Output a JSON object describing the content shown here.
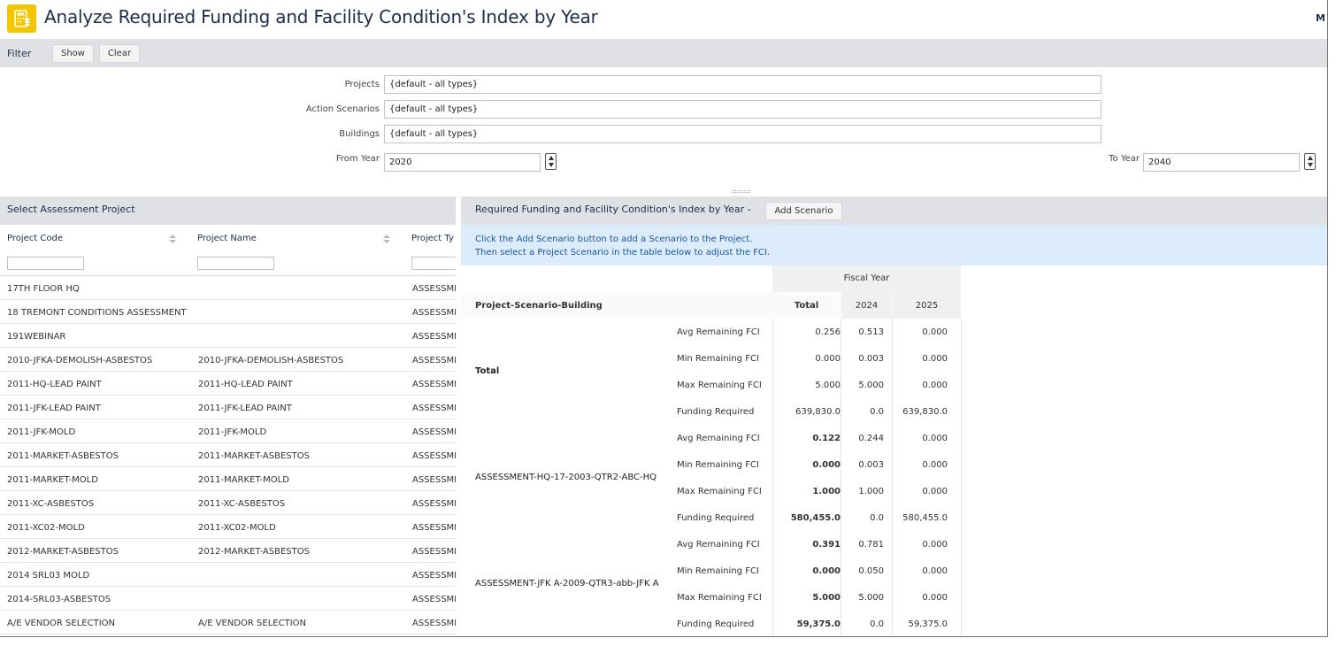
{
  "title": "Analyze Required Funding and Facility Condition's Index by Year",
  "user_initial": "M",
  "filter": {
    "label": "Filter",
    "show_label": "Show",
    "clear_label": "Clear",
    "projects_label": "Projects",
    "projects_value": "{default - all types}",
    "scenarios_label": "Action Scenarios",
    "scenarios_value": "{default - all types}",
    "buildings_label": "Buildings",
    "buildings_value": "{default - all types}",
    "from_year_label": "From Year",
    "from_year_value": "2020",
    "to_year_label": "To Year",
    "to_year_value": "2040"
  },
  "left_panel": {
    "title": "Select Assessment Project",
    "columns": [
      "Project Code",
      "Project Name",
      "Project Ty"
    ],
    "rows": [
      {
        "code": "17TH FLOOR HQ",
        "name": "",
        "type": "ASSESSME"
      },
      {
        "code": "18 TREMONT CONDITIONS ASSESSMENT",
        "name": "",
        "type": "ASSESSME"
      },
      {
        "code": "191WEBINAR",
        "name": "",
        "type": "ASSESSME"
      },
      {
        "code": "2010-JFKA-DEMOLISH-ASBESTOS",
        "name": "2010-JFKA-DEMOLISH-ASBESTOS",
        "type": "ASSESSME"
      },
      {
        "code": "2011-HQ-LEAD PAINT",
        "name": "2011-HQ-LEAD PAINT",
        "type": "ASSESSME"
      },
      {
        "code": "2011-JFK-LEAD PAINT",
        "name": "2011-JFK-LEAD PAINT",
        "type": "ASSESSME"
      },
      {
        "code": "2011-JFK-MOLD",
        "name": "2011-JFK-MOLD",
        "type": "ASSESSME"
      },
      {
        "code": "2011-MARKET-ASBESTOS",
        "name": "2011-MARKET-ASBESTOS",
        "type": "ASSESSME"
      },
      {
        "code": "2011-MARKET-MOLD",
        "name": "2011-MARKET-MOLD",
        "type": "ASSESSME"
      },
      {
        "code": "2011-XC-ASBESTOS",
        "name": "2011-XC-ASBESTOS",
        "type": "ASSESSME"
      },
      {
        "code": "2011-XC02-MOLD",
        "name": "2011-XC02-MOLD",
        "type": "ASSESSME"
      },
      {
        "code": "2012-MARKET-ASBESTOS",
        "name": "2012-MARKET-ASBESTOS",
        "type": "ASSESSME"
      },
      {
        "code": "2014 SRL03 MOLD",
        "name": "",
        "type": "ASSESSME"
      },
      {
        "code": "2014-SRL03-ASBESTOS",
        "name": "",
        "type": "ASSESSME"
      },
      {
        "code": "A/E VENDOR SELECTION",
        "name": "A/E VENDOR SELECTION",
        "type": "ASSESSME"
      }
    ]
  },
  "right_panel": {
    "title": "Required Funding and Facility Condition's Index by Year -",
    "add_scenario_label": "Add Scenario",
    "info_line1": "Click the Add Scenario button to add a Scenario to the Project.",
    "info_line2": "Then select a Project Scenario in the table below to adjust the FCI.",
    "fiscal_year_label": "Fiscal Year",
    "row_header": "Project-Scenario-Building",
    "total_header": "Total",
    "years": [
      "2024",
      "2025"
    ],
    "groups": [
      {
        "label": "Total",
        "bold_label": true,
        "rows": [
          {
            "metric": "Avg Remaining FCI",
            "total": "0.256",
            "y1": "0.513",
            "y2": "0.000"
          },
          {
            "metric": "Min Remaining FCI",
            "total": "0.000",
            "y1": "0.003",
            "y2": "0.000"
          },
          {
            "metric": "Max Remaining FCI",
            "total": "5.000",
            "y1": "5.000",
            "y2": "0.000"
          },
          {
            "metric": "Funding Required",
            "total": "639,830.0",
            "y1": "0.0",
            "y2": "639,830.0"
          }
        ]
      },
      {
        "label": "ASSESSMENT-HQ-17-2003-QTR2-ABC-HQ",
        "bold_label": false,
        "rows": [
          {
            "metric": "Avg Remaining FCI",
            "total": "0.122",
            "y1": "0.244",
            "y2": "0.000"
          },
          {
            "metric": "Min Remaining FCI",
            "total": "0.000",
            "y1": "0.003",
            "y2": "0.000"
          },
          {
            "metric": "Max Remaining FCI",
            "total": "1.000",
            "y1": "1.000",
            "y2": "0.000"
          },
          {
            "metric": "Funding Required",
            "total": "580,455.0",
            "y1": "0.0",
            "y2": "580,455.0"
          }
        ]
      },
      {
        "label": "ASSESSMENT-JFK A-2009-QTR3-abb-JFK A",
        "bold_label": false,
        "rows": [
          {
            "metric": "Avg Remaining FCI",
            "total": "0.391",
            "y1": "0.781",
            "y2": "0.000"
          },
          {
            "metric": "Min Remaining FCI",
            "total": "0.000",
            "y1": "0.050",
            "y2": "0.000"
          },
          {
            "metric": "Max Remaining FCI",
            "total": "5.000",
            "y1": "5.000",
            "y2": "0.000"
          },
          {
            "metric": "Funding Required",
            "total": "59,375.0",
            "y1": "0.0",
            "y2": "59,375.0"
          }
        ]
      }
    ]
  }
}
